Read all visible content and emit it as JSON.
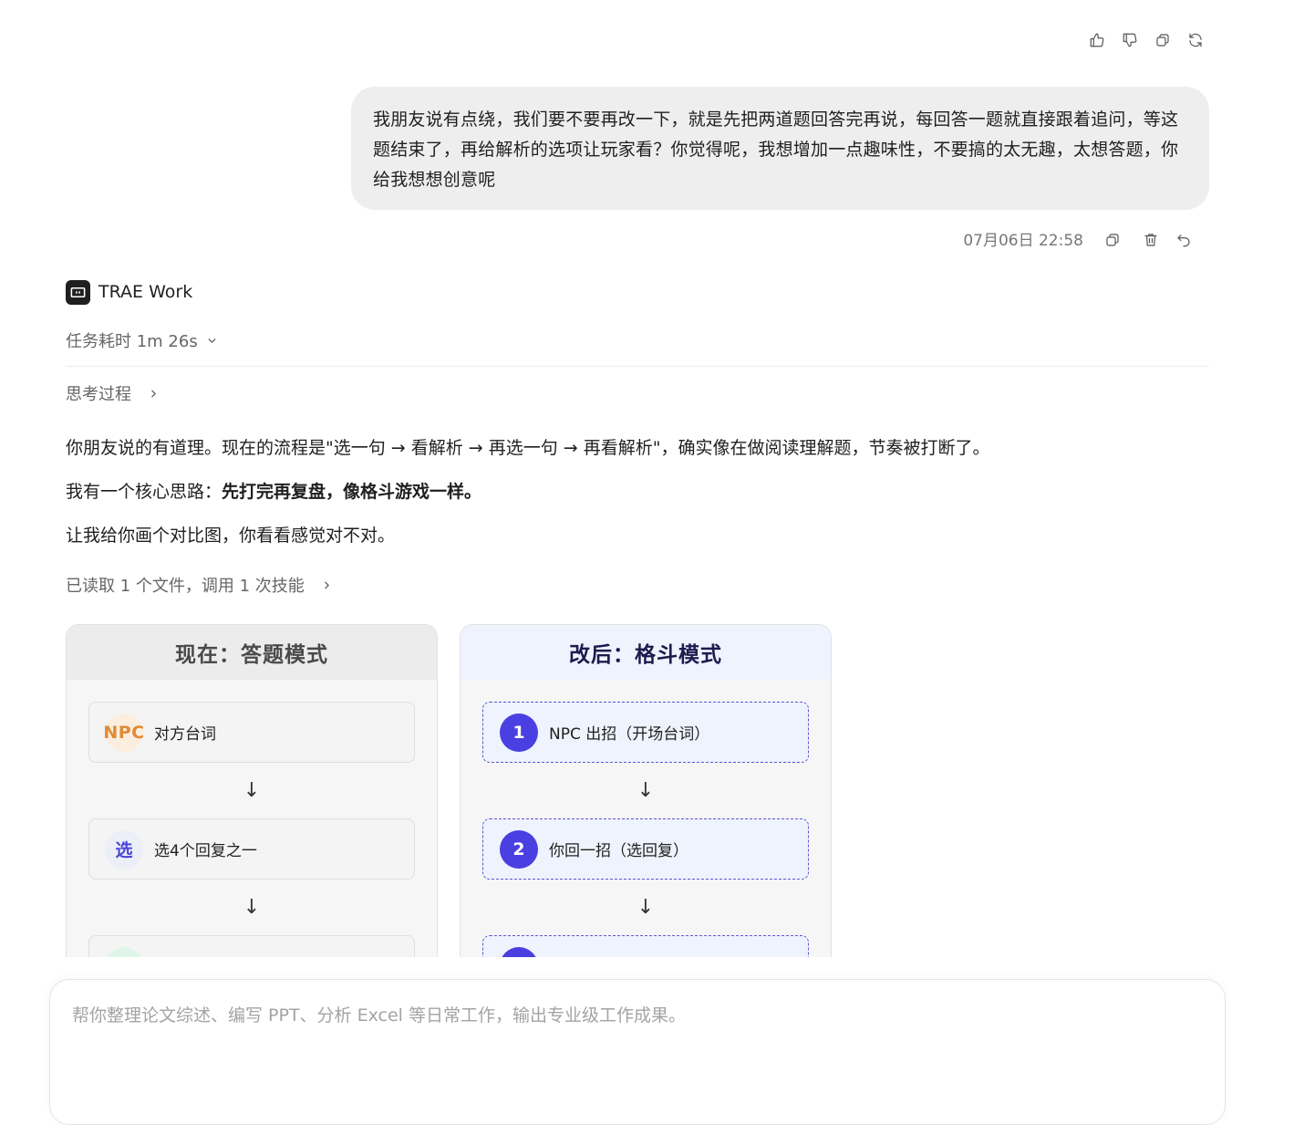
{
  "message_actions": {
    "icons": [
      "thumbs-up-icon",
      "thumbs-down-icon",
      "copy-icon",
      "refresh-icon"
    ]
  },
  "user_message": {
    "text": "我朋友说有点绕，我们要不要再改一下，就是先把两道题回答完再说，每回答一题就直接跟着追问，等这题结束了，再给解析的选项让玩家看？你觉得呢，我想增加一点趣味性，不要搞的太无趣，太想答题，你给我想想创意呢",
    "timestamp": "07月06日 22:58",
    "icons": [
      "copy-icon",
      "delete-icon",
      "undo-icon"
    ]
  },
  "agent": {
    "name": "TRAE Work",
    "task_time": "任务耗时 1m 26s",
    "thinking_label": "思考过程",
    "paragraphs": {
      "p1": "你朋友说的有道理。现在的流程是\"选一句 → 看解析 → 再选一句 → 再看解析\"，确实像在做阅读理解题，节奏被打断了。",
      "p2_prefix": "我有一个核心思路：",
      "p2_bold": "先打完再复盘，像格斗游戏一样。",
      "p3": "让我给你画个对比图，你看看感觉对不对。"
    },
    "files_summary": "已读取 1 个文件，调用 1 次技能"
  },
  "diagram": {
    "left": {
      "title": "现在：答题模式",
      "steps": [
        {
          "badge": "NPC",
          "label": "对方台词"
        },
        {
          "badge": "选",
          "label": "选4个回复之一"
        },
        {
          "badge": "",
          "label": ""
        }
      ]
    },
    "right": {
      "title": "改后：格斗模式",
      "steps": [
        {
          "badge": "1",
          "label": "NPC 出招（开场台词）"
        },
        {
          "badge": "2",
          "label": "你回一招（选回复）"
        },
        {
          "badge": "",
          "label": ""
        }
      ]
    },
    "arrow": "↓"
  },
  "composer": {
    "placeholder": "帮你整理论文综述、编写 PPT、分析 Excel 等日常工作，输出专业级工作成果。"
  }
}
